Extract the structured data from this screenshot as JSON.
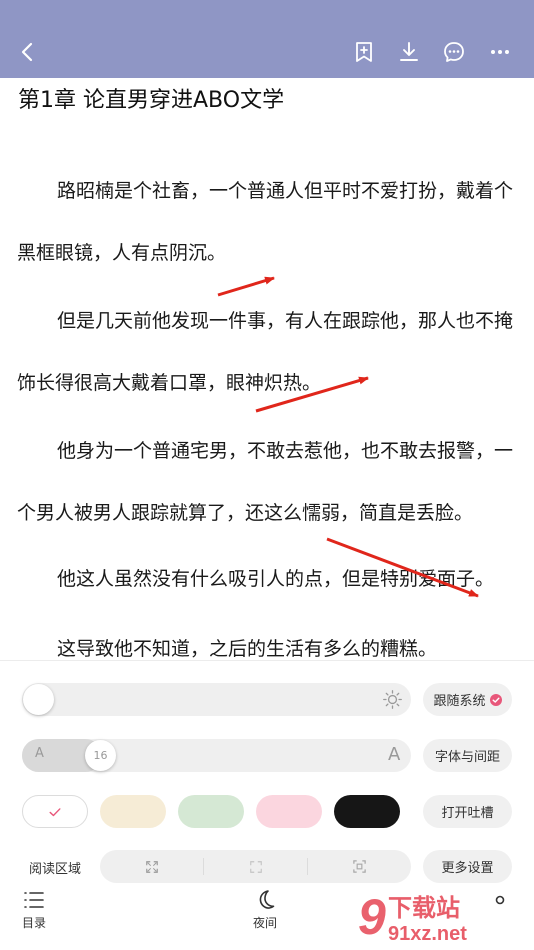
{
  "colors": {
    "header_bg": "#8f96c5",
    "accent": "#e8577a",
    "annotation_arrow": "#e0261b"
  },
  "header": {
    "icons": [
      "back-icon",
      "add-bookmark-icon",
      "download-icon",
      "comment-icon",
      "more-icon"
    ]
  },
  "reader": {
    "chapter_title": "第1章 论直男穿进ABO文学",
    "paragraphs": [
      "路昭楠是个社畜，一个普通人但平时不爱打扮，戴着个黑框眼镜，人有点阴沉。",
      "但是几天前他发现一件事，有人在跟踪他，那人也不掩饰长得很高大戴着口罩，眼神炽热。",
      "他身为一个普通宅男，不敢去惹他，也不敢去报警，一个男人被男人跟踪就算了，还这么懦弱，简直是丢脸。",
      "他这人虽然没有什么吸引人的点，但是特别爱面子。",
      "这导致他不知道，之后的生活有多么的糟糕。"
    ]
  },
  "settings": {
    "brightness": {
      "level": 0.0
    },
    "follow_system_label": "跟随系统",
    "font_size": {
      "small_label": "A",
      "large_label": "A",
      "value": "16"
    },
    "font_spacing_label": "字体与间距",
    "themes": [
      {
        "name": "white",
        "color": "#ffffff",
        "selected": true
      },
      {
        "name": "beige",
        "color": "#f6ecd6",
        "selected": false
      },
      {
        "name": "green",
        "color": "#d5e8d4",
        "selected": false
      },
      {
        "name": "pink",
        "color": "#fbd6df",
        "selected": false
      },
      {
        "name": "black",
        "color": "#161616",
        "selected": false
      }
    ],
    "open_comments_label": "打开吐槽",
    "reading_area_label": "阅读区域",
    "reading_area_icons": [
      "expand-icon",
      "shrink-icon",
      "focus-icon"
    ],
    "more_settings_label": "更多设置"
  },
  "bottom_nav": {
    "toc_label": "目录",
    "night_label": "夜间",
    "third_label": "下载站"
  },
  "watermark": {
    "text": "下载站",
    "url": "91xz.net"
  }
}
